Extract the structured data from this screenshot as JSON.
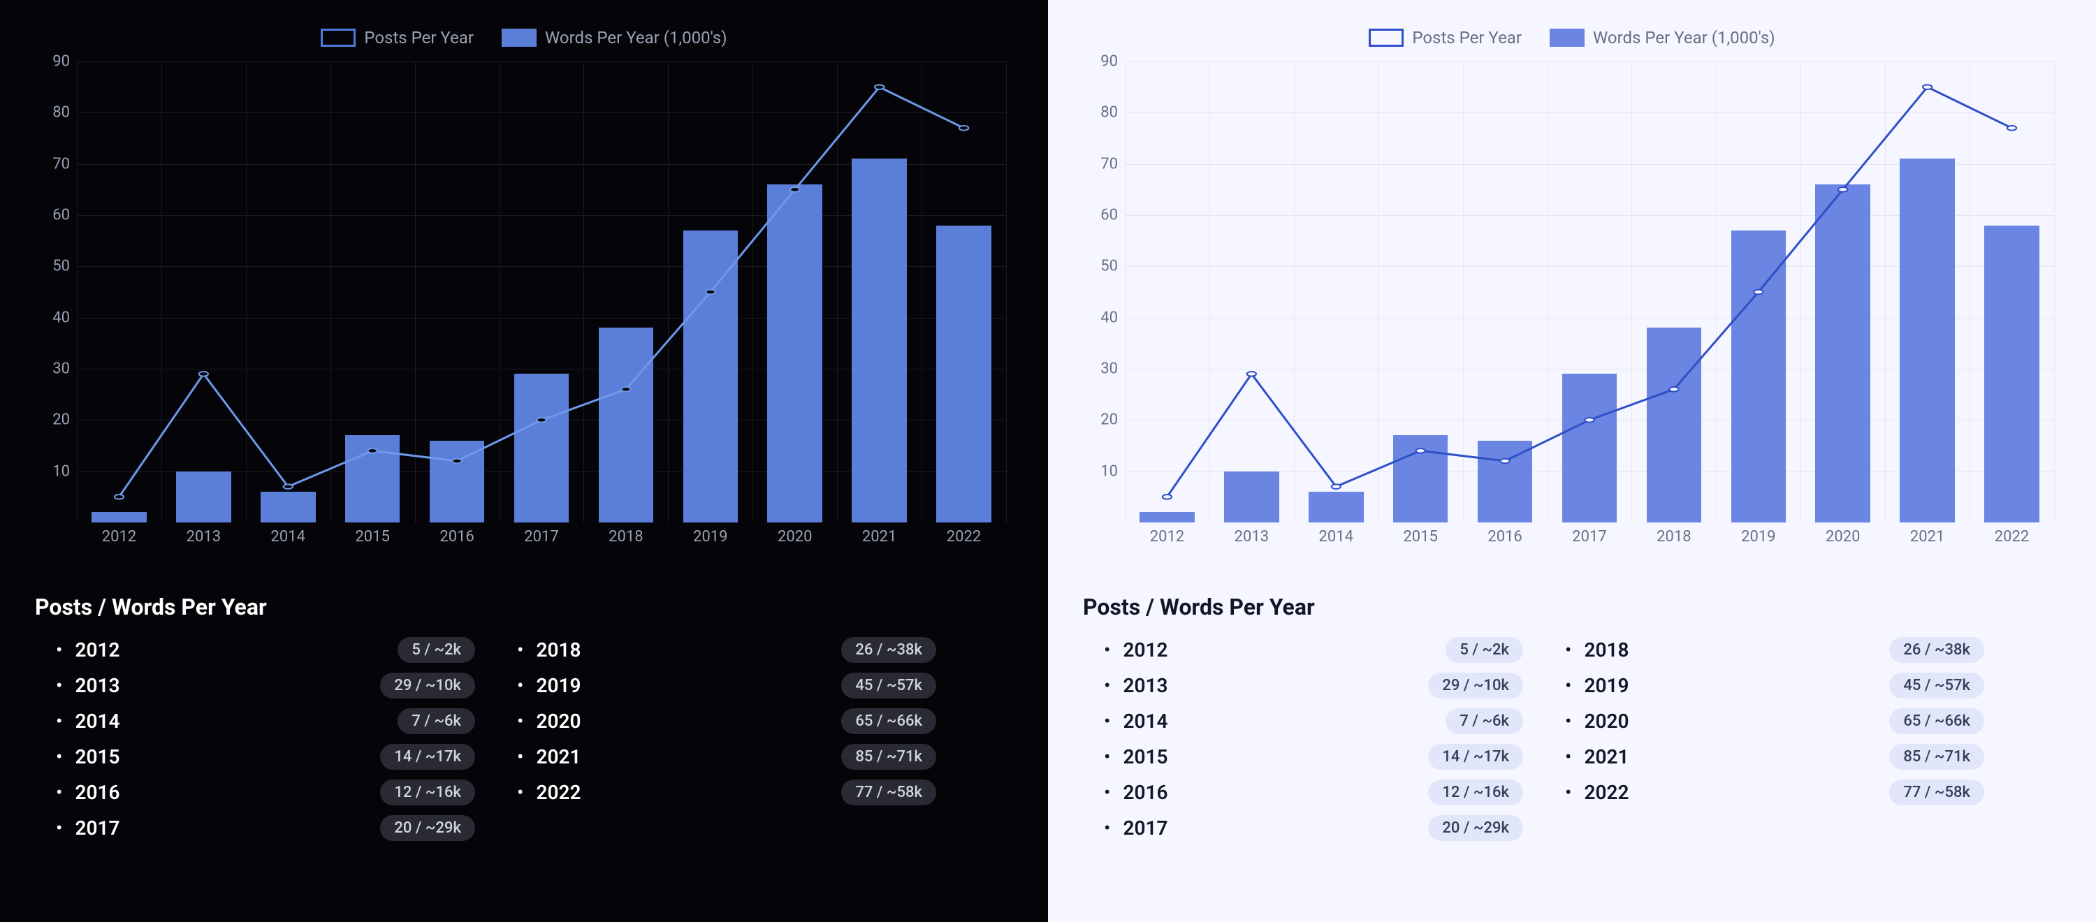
{
  "chart_data": {
    "type": "bar+line",
    "categories": [
      "2012",
      "2013",
      "2014",
      "2015",
      "2016",
      "2017",
      "2018",
      "2019",
      "2020",
      "2021",
      "2022"
    ],
    "series": [
      {
        "name": "Posts Per Year",
        "type": "line",
        "values": [
          5,
          29,
          7,
          14,
          12,
          20,
          26,
          45,
          65,
          85,
          77
        ]
      },
      {
        "name": "Words Per Year (1,000's)",
        "type": "bar",
        "values": [
          2,
          10,
          6,
          17,
          16,
          29,
          38,
          57,
          66,
          71,
          58
        ]
      }
    ],
    "ylim": [
      0,
      90
    ],
    "yticks": [
      10,
      20,
      30,
      40,
      50,
      60,
      70,
      80,
      90
    ],
    "xlabel": "",
    "ylabel": ""
  },
  "legend": {
    "line_label": "Posts Per Year",
    "bar_label": "Words Per Year (1,000's)"
  },
  "section_title": "Posts / Words Per Year",
  "rows_col1": [
    {
      "year": "2012",
      "badge": "5 / ~2k"
    },
    {
      "year": "2013",
      "badge": "29 / ~10k"
    },
    {
      "year": "2014",
      "badge": "7 / ~6k"
    },
    {
      "year": "2015",
      "badge": "14 / ~17k"
    },
    {
      "year": "2016",
      "badge": "12 / ~16k"
    },
    {
      "year": "2017",
      "badge": "20 / ~29k"
    }
  ],
  "rows_col2": [
    {
      "year": "2018",
      "badge": "26 / ~38k"
    },
    {
      "year": "2019",
      "badge": "45 / ~57k"
    },
    {
      "year": "2020",
      "badge": "65 / ~66k"
    },
    {
      "year": "2021",
      "badge": "85 / ~71k"
    },
    {
      "year": "2022",
      "badge": "77 / ~58k"
    }
  ]
}
